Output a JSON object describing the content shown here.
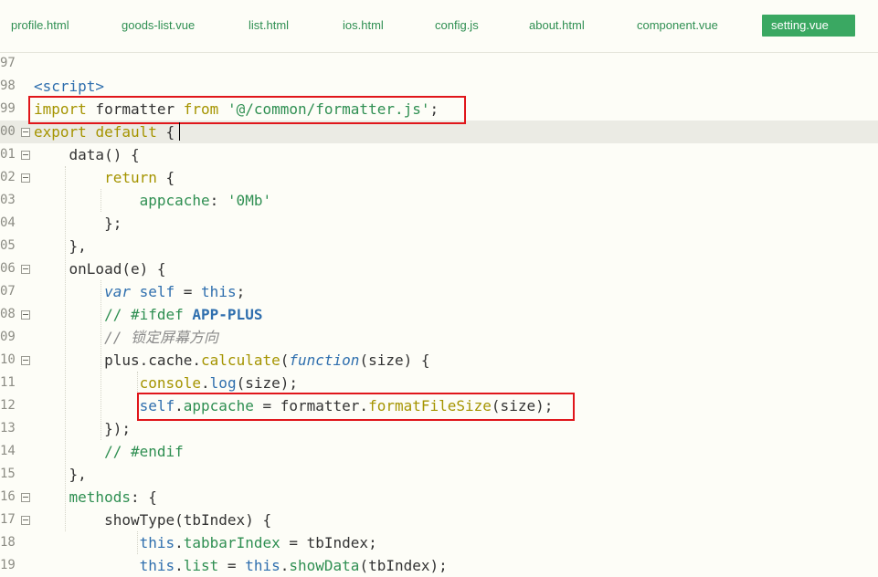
{
  "tabs": [
    {
      "label": "profile.html",
      "active": false
    },
    {
      "label": "goods-list.vue",
      "active": false
    },
    {
      "label": "list.html",
      "active": false
    },
    {
      "label": "ios.html",
      "active": false
    },
    {
      "label": "config.js",
      "active": false
    },
    {
      "label": "about.html",
      "active": false
    },
    {
      "label": "component.vue",
      "active": false
    },
    {
      "label": "setting.vue",
      "active": true
    }
  ],
  "editor": {
    "current_line": "00",
    "lines": [
      {
        "n": "97",
        "fold": false,
        "tokens": []
      },
      {
        "n": "98",
        "fold": false,
        "tokens": [
          {
            "t": "<script>",
            "c": "tag"
          }
        ]
      },
      {
        "n": "99",
        "fold": false,
        "tokens": [
          {
            "t": "import",
            "c": "kw"
          },
          {
            "t": " formatter ",
            "c": "plain"
          },
          {
            "t": "from",
            "c": "kw"
          },
          {
            "t": " ",
            "c": "plain"
          },
          {
            "t": "'@/common/formatter.js'",
            "c": "str"
          },
          {
            "t": ";",
            "c": "plain"
          }
        ]
      },
      {
        "n": "00",
        "fold": true,
        "tokens": [
          {
            "t": "export",
            "c": "kw"
          },
          {
            "t": " ",
            "c": "plain"
          },
          {
            "t": "default",
            "c": "kw"
          },
          {
            "t": " {",
            "c": "plain"
          }
        ]
      },
      {
        "n": "01",
        "fold": true,
        "tokens": [
          {
            "t": "    data() {",
            "c": "plain"
          }
        ]
      },
      {
        "n": "02",
        "fold": true,
        "tokens": [
          {
            "t": "        ",
            "c": "plain"
          },
          {
            "t": "return",
            "c": "kw"
          },
          {
            "t": " {",
            "c": "plain"
          }
        ]
      },
      {
        "n": "03",
        "fold": false,
        "tokens": [
          {
            "t": "            ",
            "c": "plain"
          },
          {
            "t": "appcache",
            "c": "prop"
          },
          {
            "t": ": ",
            "c": "plain"
          },
          {
            "t": "'0Mb'",
            "c": "str"
          }
        ]
      },
      {
        "n": "04",
        "fold": false,
        "tokens": [
          {
            "t": "        };",
            "c": "plain"
          }
        ]
      },
      {
        "n": "05",
        "fold": false,
        "tokens": [
          {
            "t": "    },",
            "c": "plain"
          }
        ]
      },
      {
        "n": "06",
        "fold": true,
        "tokens": [
          {
            "t": "    onLoad(e) {",
            "c": "plain"
          }
        ]
      },
      {
        "n": "07",
        "fold": false,
        "tokens": [
          {
            "t": "        ",
            "c": "plain"
          },
          {
            "t": "var",
            "c": "var"
          },
          {
            "t": " ",
            "c": "plain"
          },
          {
            "t": "self",
            "c": "this"
          },
          {
            "t": " = ",
            "c": "plain"
          },
          {
            "t": "this",
            "c": "this"
          },
          {
            "t": ";",
            "c": "plain"
          }
        ]
      },
      {
        "n": "08",
        "fold": true,
        "tokens": [
          {
            "t": "        ",
            "c": "plain"
          },
          {
            "t": "// #ifdef ",
            "c": "prep"
          },
          {
            "t": "APP-PLUS",
            "c": "prepkw"
          }
        ]
      },
      {
        "n": "09",
        "fold": false,
        "tokens": [
          {
            "t": "        ",
            "c": "plain"
          },
          {
            "t": "// 锁定屏幕方向",
            "c": "com"
          }
        ]
      },
      {
        "n": "10",
        "fold": true,
        "tokens": [
          {
            "t": "        plus.cache.",
            "c": "plain"
          },
          {
            "t": "calculate",
            "c": "fn"
          },
          {
            "t": "(",
            "c": "plain"
          },
          {
            "t": "function",
            "c": "ital"
          },
          {
            "t": "(size) {",
            "c": "plain"
          }
        ]
      },
      {
        "n": "11",
        "fold": false,
        "tokens": [
          {
            "t": "            ",
            "c": "plain"
          },
          {
            "t": "console",
            "c": "fn"
          },
          {
            "t": ".",
            "c": "plain"
          },
          {
            "t": "log",
            "c": "this"
          },
          {
            "t": "(size);",
            "c": "plain"
          }
        ]
      },
      {
        "n": "12",
        "fold": false,
        "tokens": [
          {
            "t": "            ",
            "c": "plain"
          },
          {
            "t": "self",
            "c": "this"
          },
          {
            "t": ".",
            "c": "plain"
          },
          {
            "t": "appcache",
            "c": "prop"
          },
          {
            "t": " = formatter.",
            "c": "plain"
          },
          {
            "t": "formatFileSize",
            "c": "fn"
          },
          {
            "t": "(size);",
            "c": "plain"
          }
        ]
      },
      {
        "n": "13",
        "fold": false,
        "tokens": [
          {
            "t": "        });",
            "c": "plain"
          }
        ]
      },
      {
        "n": "14",
        "fold": false,
        "tokens": [
          {
            "t": "        ",
            "c": "plain"
          },
          {
            "t": "// #endif",
            "c": "prep"
          }
        ]
      },
      {
        "n": "15",
        "fold": false,
        "tokens": [
          {
            "t": "    },",
            "c": "plain"
          }
        ]
      },
      {
        "n": "16",
        "fold": true,
        "tokens": [
          {
            "t": "    ",
            "c": "plain"
          },
          {
            "t": "methods",
            "c": "prop"
          },
          {
            "t": ": {",
            "c": "plain"
          }
        ]
      },
      {
        "n": "17",
        "fold": true,
        "tokens": [
          {
            "t": "        showType(tbIndex) {",
            "c": "plain"
          }
        ]
      },
      {
        "n": "18",
        "fold": false,
        "tokens": [
          {
            "t": "            ",
            "c": "plain"
          },
          {
            "t": "this",
            "c": "this"
          },
          {
            "t": ".",
            "c": "plain"
          },
          {
            "t": "tabbarIndex",
            "c": "prop"
          },
          {
            "t": " = tbIndex;",
            "c": "plain"
          }
        ]
      },
      {
        "n": "19",
        "fold": false,
        "tokens": [
          {
            "t": "            ",
            "c": "plain"
          },
          {
            "t": "this",
            "c": "this"
          },
          {
            "t": ".",
            "c": "plain"
          },
          {
            "t": "list",
            "c": "prop"
          },
          {
            "t": " = ",
            "c": "plain"
          },
          {
            "t": "this",
            "c": "this"
          },
          {
            "t": ".",
            "c": "plain"
          },
          {
            "t": "showData",
            "c": "prop"
          },
          {
            "t": "(tbIndex);",
            "c": "plain"
          }
        ]
      }
    ]
  }
}
